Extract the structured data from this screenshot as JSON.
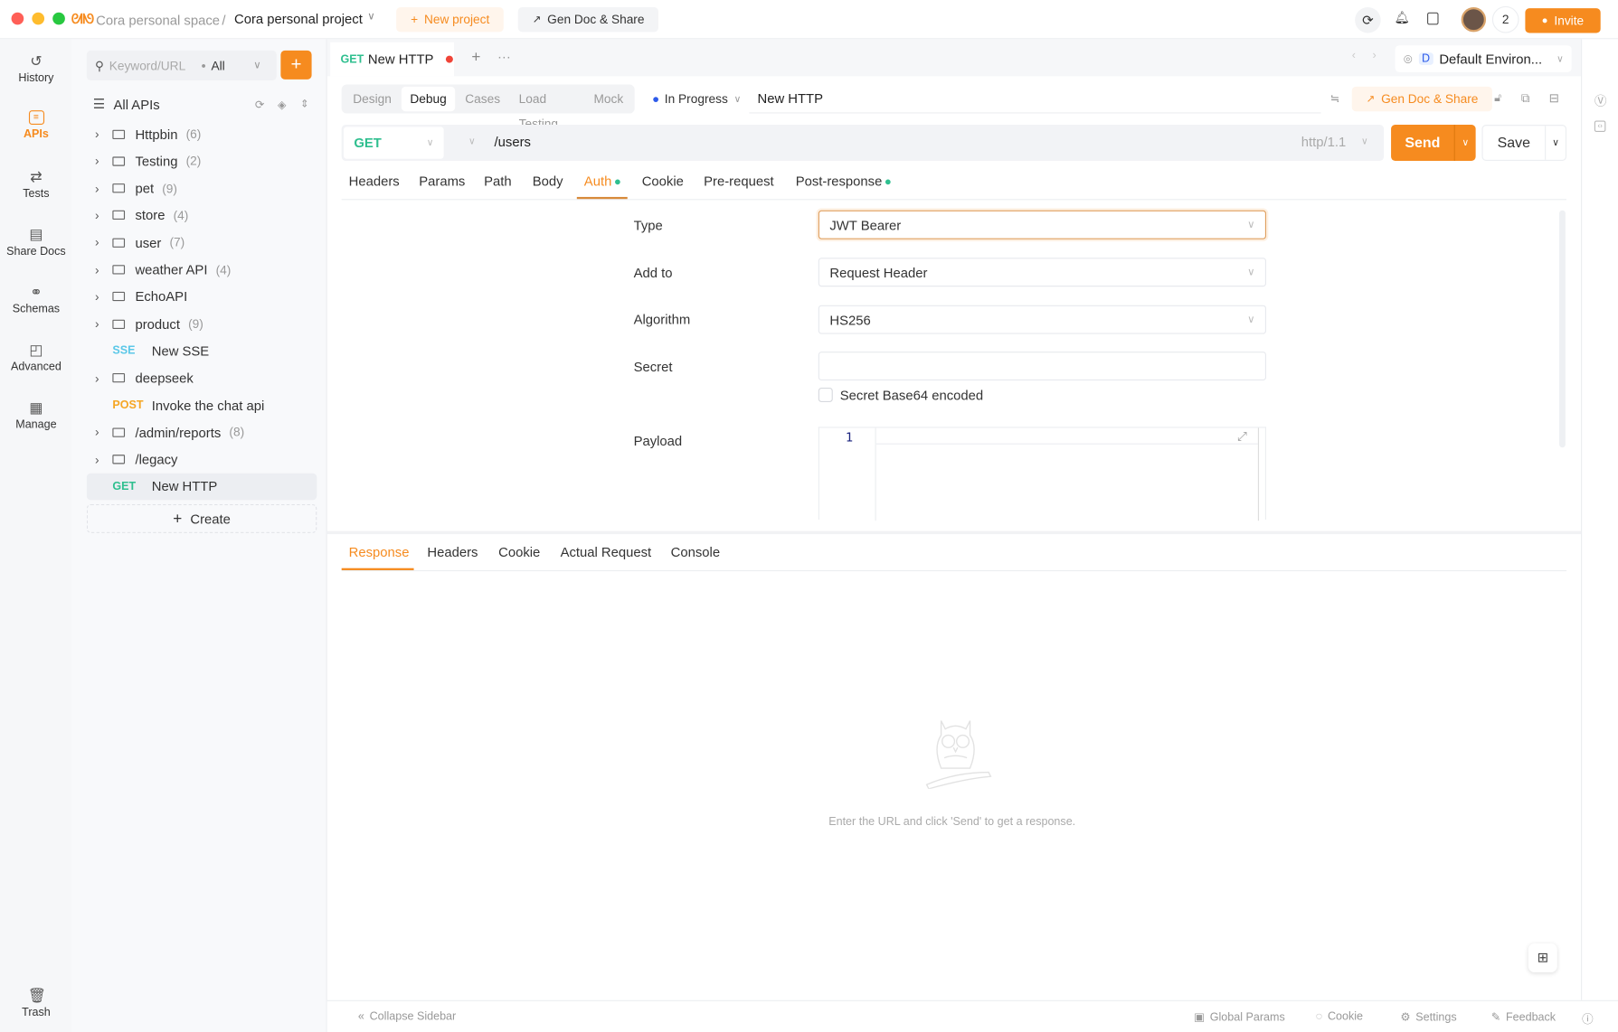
{
  "titlebar": {
    "workspace": "Cora personal space",
    "separator": "/",
    "project": "Cora personal project",
    "new_project": "New project",
    "gen_doc_share": "Gen Doc & Share",
    "member_count": "2",
    "invite": "Invite"
  },
  "leftnav": {
    "items": [
      {
        "label": "History",
        "icon": "history-icon"
      },
      {
        "label": "APIs",
        "icon": "apis-icon",
        "active": true
      },
      {
        "label": "Tests",
        "icon": "tests-icon"
      },
      {
        "label": "Share Docs",
        "icon": "share-docs-icon"
      },
      {
        "label": "Schemas",
        "icon": "schemas-icon"
      },
      {
        "label": "Advanced",
        "icon": "advanced-icon"
      },
      {
        "label": "Manage",
        "icon": "manage-icon"
      }
    ],
    "trash": "Trash"
  },
  "tree": {
    "search_placeholder": "Keyword/URL",
    "filter": "All",
    "root": "All APIs",
    "items": [
      {
        "type": "folder",
        "name": "Httpbin",
        "count": "(6)"
      },
      {
        "type": "folder",
        "name": "Testing",
        "count": "(2)"
      },
      {
        "type": "folder",
        "name": "pet",
        "count": "(9)"
      },
      {
        "type": "folder",
        "name": "store",
        "count": "(4)"
      },
      {
        "type": "folder",
        "name": "user",
        "count": "(7)"
      },
      {
        "type": "folder",
        "name": "weather API",
        "count": "(4)"
      },
      {
        "type": "folder",
        "name": "EchoAPI",
        "count": ""
      },
      {
        "type": "folder",
        "name": "product",
        "count": "(9)"
      },
      {
        "type": "request",
        "method": "SSE",
        "name": "New SSE"
      },
      {
        "type": "folder",
        "name": "deepseek",
        "count": ""
      },
      {
        "type": "request",
        "method": "POST",
        "name": "Invoke the chat api"
      },
      {
        "type": "folder",
        "name": "/admin/reports",
        "count": "(8)"
      },
      {
        "type": "folder",
        "name": "/legacy",
        "count": ""
      },
      {
        "type": "request",
        "method": "GET",
        "name": "New HTTP",
        "selected": true
      }
    ],
    "create": "Create"
  },
  "tabs": {
    "active": {
      "method": "GET",
      "name": "New HTTP"
    },
    "environment_badge": "D",
    "environment": "Default Environ..."
  },
  "modes": [
    "Design",
    "Debug",
    "Cases",
    "Load Testing",
    "Mock"
  ],
  "active_mode": "Debug",
  "status": "In Progress",
  "request_name": "New HTTP",
  "gen_doc_share": "Gen Doc & Share",
  "request": {
    "method": "GET",
    "url": "/users",
    "protocol": "http/1.1",
    "send": "Send",
    "save": "Save"
  },
  "request_tabs": [
    "Headers",
    "Params",
    "Path",
    "Body",
    "Auth",
    "Cookie",
    "Pre-request",
    "Post-response"
  ],
  "active_request_tab": "Auth",
  "auth": {
    "type_label": "Type",
    "type_value": "JWT Bearer",
    "addto_label": "Add to",
    "addto_value": "Request Header",
    "algorithm_label": "Algorithm",
    "algorithm_value": "HS256",
    "secret_label": "Secret",
    "secret_value": "",
    "base64_label": "Secret Base64 encoded",
    "base64_checked": false,
    "payload_label": "Payload",
    "payload_line": "1"
  },
  "response_tabs": [
    "Response",
    "Headers",
    "Cookie",
    "Actual Request",
    "Console"
  ],
  "active_response_tab": "Response",
  "empty_message": "Enter the URL and click 'Send' to get a response.",
  "statusbar": {
    "collapse": "Collapse Sidebar",
    "global_params": "Global Params",
    "cookie": "Cookie",
    "settings": "Settings",
    "feedback": "Feedback"
  },
  "colors": {
    "accent": "#f68b1f",
    "get": "#2fbf8f",
    "post": "#f5a623",
    "sse": "#5cc8e8",
    "status_dot": "#2d5bea",
    "unsaved_dot": "#f04438"
  }
}
